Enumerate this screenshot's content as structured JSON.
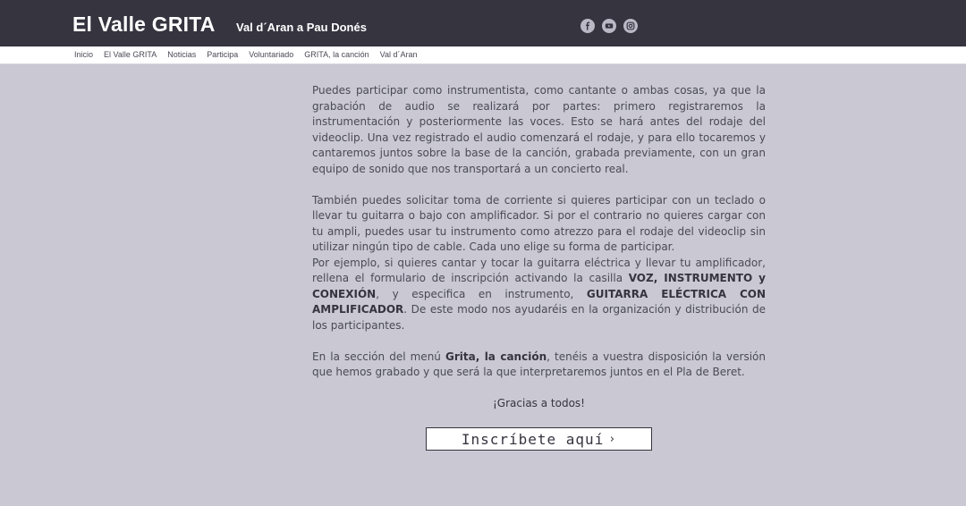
{
  "header": {
    "title": "El Valle GRITA",
    "subtitle": "Val d´Aran a Pau Donés",
    "social": [
      "facebook-icon",
      "youtube-icon",
      "instagram-icon"
    ]
  },
  "nav": {
    "items": [
      "Inicio",
      "El Valle GRITA",
      "Noticias",
      "Participa",
      "Voluntariado",
      "GRITA, la canción",
      "Val d´Aran"
    ]
  },
  "content": {
    "p1": "Puedes participar como instrumentista, como cantante o ambas cosas, ya que la grabación de audio se realizará por partes: primero registraremos la instrumentación y posteriormente las voces. Esto se hará antes del rodaje del videoclip. Una vez registrado el audio comenzará el rodaje, y para ello tocaremos y cantaremos juntos sobre la base de la canción, grabada previamente, con un gran equipo de sonido que nos transportará a un concierto real.",
    "p2": "También puedes solicitar toma de corriente si quieres participar con un teclado o llevar tu guitarra o bajo con amplificador. Si por el contrario no quieres cargar con tu ampli, puedes usar tu instrumento como atrezzo para el rodaje del videoclip sin utilizar ningún tipo de cable. Cada uno elige su forma de participar.",
    "p3_a": "Por ejemplo, si quieres cantar y tocar la guitarra eléctrica y llevar tu amplificador, rellena el formulario de inscripción activando la casilla ",
    "p3_b": "VOZ, INSTRUMENTO y CONEXIÓN",
    "p3_c": ", y especifica en instrumento, ",
    "p3_d": "GUITARRA ELÉCTRICA CON AMPLIFICADOR",
    "p3_e": ". De este modo nos ayudaréis en la organización y distribución de los participantes.",
    "p4_a": "En la sección del menú ",
    "p4_b": "Grita, la canción",
    "p4_c": ", tenéis a vuestra disposición la versión que hemos grabado y que será la que interpretaremos juntos en el Pla de Beret.",
    "thanks": "¡Gracias a todos!"
  },
  "cta": {
    "label": "Inscríbete aquí",
    "chevron": "›"
  }
}
